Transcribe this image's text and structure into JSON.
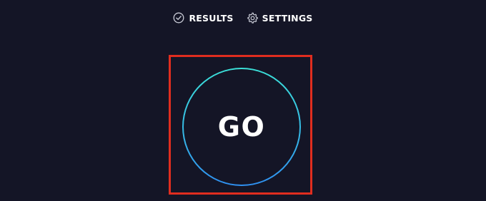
{
  "nav": {
    "items": [
      {
        "label": "RESULTS",
        "icon": "check-circle-icon"
      },
      {
        "label": "SETTINGS",
        "icon": "gear-icon"
      }
    ]
  },
  "go_button": {
    "label": "GO"
  },
  "colors": {
    "background": "#141526",
    "ring_top": "#3be0d8",
    "ring_bottom": "#2f8ff0",
    "highlight": "#e02d1f",
    "text": "#ffffff"
  }
}
